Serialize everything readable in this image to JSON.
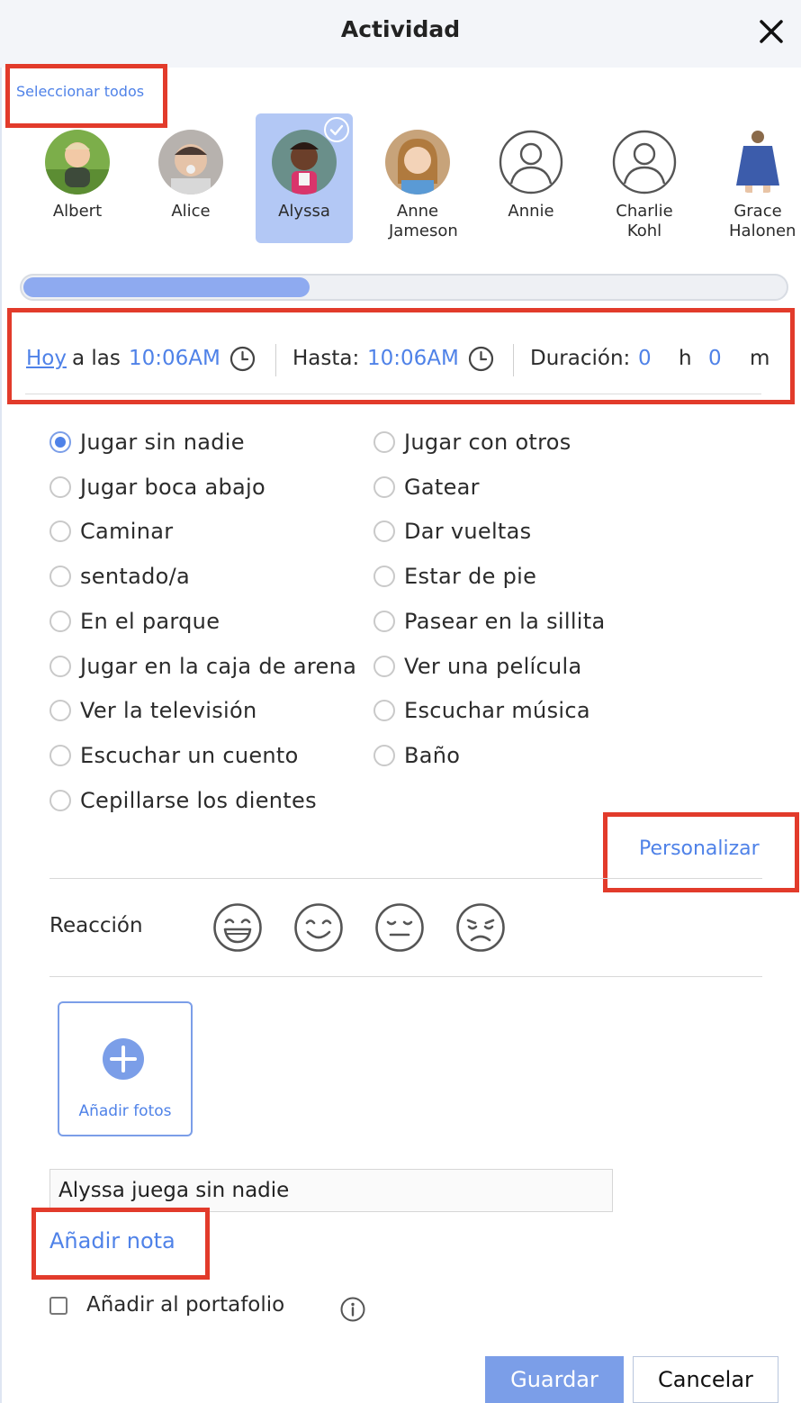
{
  "header": {
    "title": "Actividad"
  },
  "select_all_label": "Seleccionar todos",
  "children": [
    {
      "name": "Albert",
      "selected": false,
      "avatar": "photo"
    },
    {
      "name": "Alice",
      "selected": false,
      "avatar": "photo"
    },
    {
      "name": "Alyssa",
      "selected": true,
      "avatar": "photo"
    },
    {
      "name": "Anne Jameson",
      "selected": false,
      "avatar": "photo"
    },
    {
      "name": "Annie",
      "selected": false,
      "avatar": "placeholder"
    },
    {
      "name": "Charlie Kohl",
      "selected": false,
      "avatar": "placeholder"
    },
    {
      "name": "Grace Halonen",
      "selected": false,
      "avatar": "photo"
    }
  ],
  "time": {
    "day_link": "Hoy",
    "at_label": "a las",
    "start": "10:06AM",
    "until_label": "Hasta:",
    "end": "10:06AM",
    "duration_label": "Duración:",
    "hours": "0",
    "hours_unit": "h",
    "minutes": "0",
    "minutes_unit": "m"
  },
  "activities": [
    {
      "label": "Jugar sin nadie",
      "selected": true
    },
    {
      "label": "Jugar con otros",
      "selected": false
    },
    {
      "label": "Jugar boca abajo",
      "selected": false
    },
    {
      "label": "Gatear",
      "selected": false
    },
    {
      "label": "Caminar",
      "selected": false
    },
    {
      "label": "Dar vueltas",
      "selected": false
    },
    {
      "label": "sentado/a",
      "selected": false
    },
    {
      "label": "Estar de pie",
      "selected": false
    },
    {
      "label": "En el parque",
      "selected": false
    },
    {
      "label": "Pasear en la sillita",
      "selected": false
    },
    {
      "label": "Jugar en la caja de arena",
      "selected": false
    },
    {
      "label": "Ver una película",
      "selected": false
    },
    {
      "label": "Ver la televisión",
      "selected": false
    },
    {
      "label": "Escuchar música",
      "selected": false
    },
    {
      "label": "Escuchar un cuento",
      "selected": false
    },
    {
      "label": "Baño",
      "selected": false
    },
    {
      "label": "Cepillarse los dientes",
      "selected": false
    }
  ],
  "customize_label": "Personalizar",
  "reaction": {
    "label": "Reacción",
    "options": [
      "grinning-face-icon",
      "smiling-face-icon",
      "neutral-face-icon",
      "sad-face-icon"
    ]
  },
  "photos": {
    "add_label": "Añadir fotos"
  },
  "note": {
    "value": "Alyssa juega sin nadie",
    "add_label": "Añadir nota"
  },
  "portfolio": {
    "label": "Añadir al portafolio",
    "checked": false
  },
  "buttons": {
    "save": "Guardar",
    "cancel": "Cancelar"
  },
  "colors": {
    "accent": "#4f82e8",
    "selected_bg": "#b3c8f5",
    "annotation": "#e23b2b"
  }
}
